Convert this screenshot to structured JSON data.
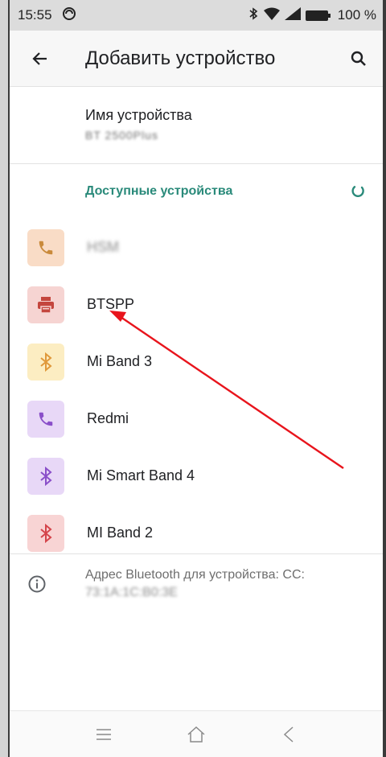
{
  "status_bar": {
    "time": "15:55",
    "battery_percent": "100 %"
  },
  "app_bar": {
    "title": "Добавить устройство",
    "back_icon": "arrow-back-icon",
    "search_icon": "search-icon"
  },
  "device_name": {
    "label": "Имя устройства",
    "value": "BT 2500Plus"
  },
  "available": {
    "header": "Доступные устройства",
    "devices": [
      {
        "label": "HSM",
        "icon": "phone-icon",
        "icon_color": "#c98a3b",
        "bg_color": "#f9dcc6",
        "blurred": true
      },
      {
        "label": "BTSPP",
        "icon": "printer-icon",
        "icon_color": "#c4463e",
        "bg_color": "#f6d4d2",
        "blurred": false
      },
      {
        "label": "Mi Band 3",
        "icon": "bluetooth-icon",
        "icon_color": "#e0983a",
        "bg_color": "#fcedc2",
        "blurred": false
      },
      {
        "label": "Redmi",
        "icon": "phone-icon",
        "icon_color": "#8a4fc9",
        "bg_color": "#e8d8f7",
        "blurred": false
      },
      {
        "label": "Mi Smart Band 4",
        "icon": "bluetooth-icon",
        "icon_color": "#8a4fc9",
        "bg_color": "#e8d8f7",
        "blurred": false
      },
      {
        "label": "MI Band 2",
        "icon": "bluetooth-icon",
        "icon_color": "#d4444a",
        "bg_color": "#f8d4d4",
        "blurred": false
      }
    ]
  },
  "info": {
    "text": "Адрес Bluetooth для устройства: CC:",
    "mac": "73:1A:1C:B0:3E"
  },
  "colors": {
    "accent": "#2a8a7a",
    "annotation_arrow": "#e8141c"
  }
}
